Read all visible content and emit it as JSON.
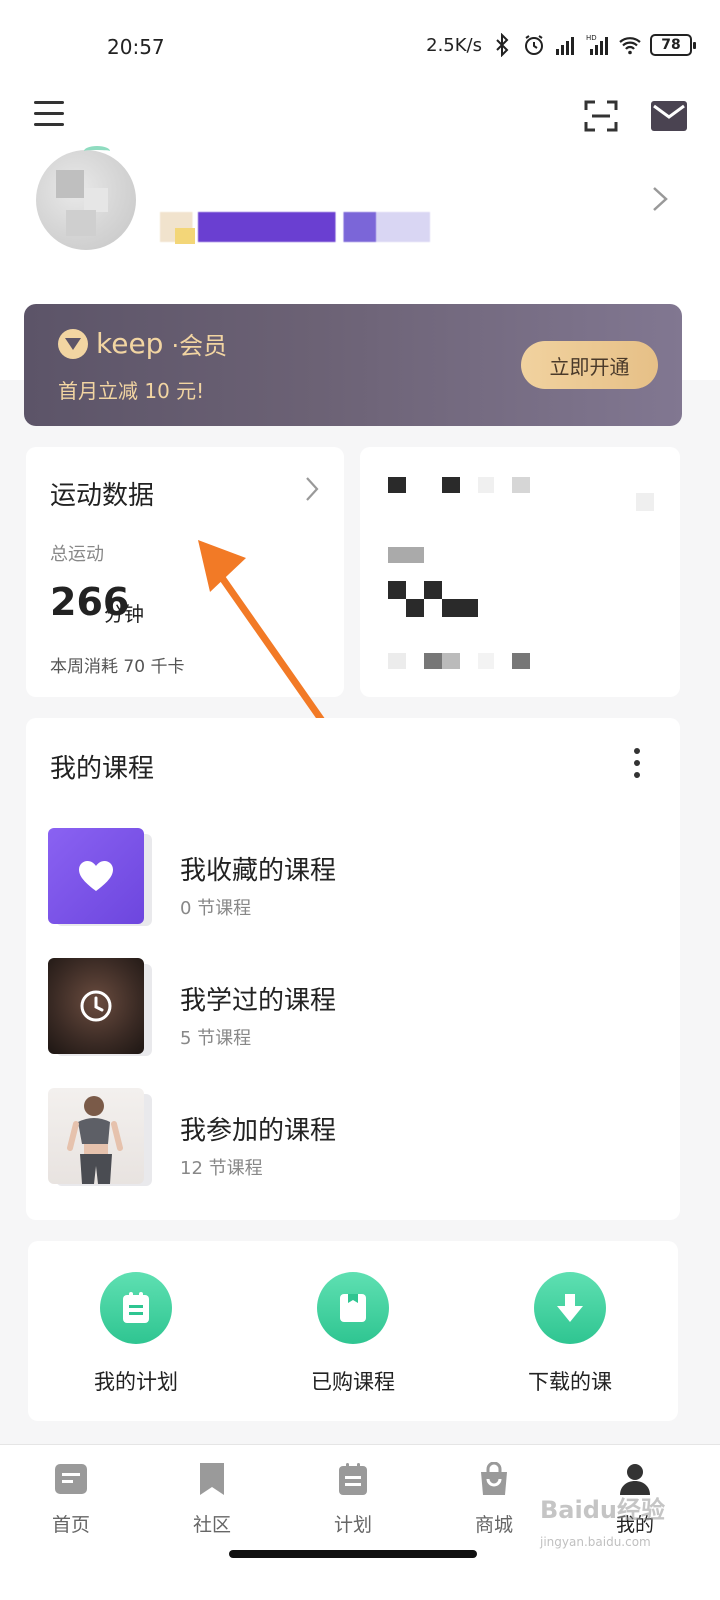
{
  "status_bar": {
    "time": "20:57",
    "net_speed": "2.5K/s",
    "battery": "78",
    "icons": [
      "bluetooth-icon",
      "alarm-icon",
      "signal-icon",
      "hd-signal-icon",
      "wifi-icon"
    ]
  },
  "top_bar": {
    "icons": [
      "menu-icon",
      "scan-icon",
      "mail-icon"
    ]
  },
  "vip": {
    "brand": "keep",
    "brand_suffix": "·会员",
    "promo": "首月立减 10 元!",
    "button": "立即开通",
    "accent_color": "#f2d5a2"
  },
  "sport": {
    "title": "运动数据",
    "total_label": "总运动",
    "total_value": "266",
    "total_unit": "分钟",
    "week": "本周消耗 70 千卡"
  },
  "courses": {
    "title": "我的课程",
    "items": [
      {
        "name": "我收藏的课程",
        "count": "0 节课程",
        "icon": "heart-icon"
      },
      {
        "name": "我学过的课程",
        "count": "5 节课程",
        "icon": "clock-icon"
      },
      {
        "name": "我参加的课程",
        "count": "12 节课程",
        "icon": "photo-thumbnail"
      }
    ]
  },
  "actions": [
    {
      "label": "我的计划",
      "icon": "plan-icon"
    },
    {
      "label": "已购课程",
      "icon": "bag-icon"
    },
    {
      "label": "下载的课",
      "icon": "download-icon"
    }
  ],
  "nav": [
    {
      "label": "首页",
      "icon": "home-icon"
    },
    {
      "label": "社区",
      "icon": "bookmark-icon"
    },
    {
      "label": "计划",
      "icon": "clipboard-icon"
    },
    {
      "label": "商城",
      "icon": "shop-bag-icon"
    },
    {
      "label": "我的",
      "icon": "profile-icon"
    }
  ],
  "watermark": {
    "text": "Baidu经验",
    "sub": "jingyan.baidu.com"
  },
  "theme": {
    "green": "#2fc591",
    "purple": "#6d46de",
    "arrow": "#f27a26"
  }
}
